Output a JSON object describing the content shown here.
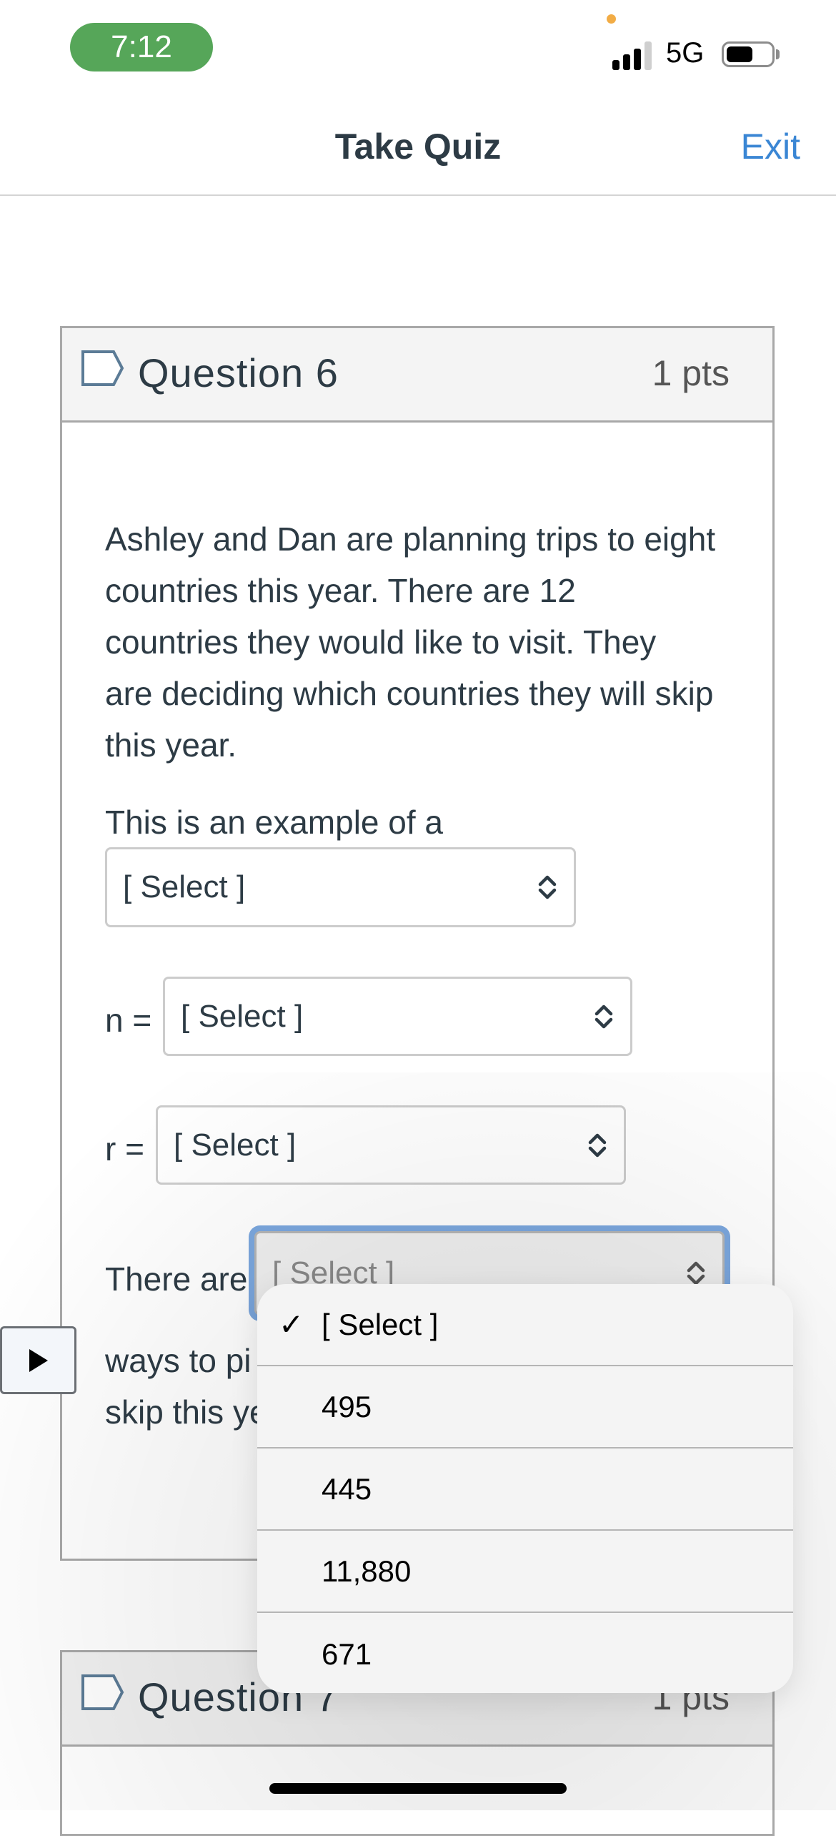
{
  "status_bar": {
    "time": "7:12",
    "network": "5G",
    "signal_bars_active": 3,
    "signal_bars_total": 4,
    "battery_level_percent": 60,
    "time_pill_color": "#56a659",
    "privacy_dot_color": "#f2ac45"
  },
  "header": {
    "title": "Take Quiz",
    "exit_label": "Exit",
    "accent_color": "#3a86d4"
  },
  "question6": {
    "title": "Question 6",
    "points": "1 pts",
    "flag_icon": "flag-outline-icon",
    "body_lines": [
      "Ashley and Dan are planning trips to eight",
      "countries this year.  There are 12",
      "countries they would like to visit.  They",
      "are deciding which countries they will skip",
      "this year."
    ],
    "prompt_example": "This is an example of a",
    "select_example_value": "[ Select ]",
    "n_label": "n =",
    "select_n_value": "[ Select ]",
    "r_label": "r =",
    "select_r_value": "[ Select ]",
    "there_are_label": "There are",
    "select_ways_value": "[ Select ]",
    "ways_line_1_visible": "ways to pi",
    "ways_line_2_visible": "skip this ye"
  },
  "dropdown": {
    "selected_index": 0,
    "check_glyph": "✓",
    "options": [
      "[ Select ]",
      "495",
      "445",
      "11,880",
      "671"
    ]
  },
  "question7": {
    "title": "Question 7",
    "points": "1 pts"
  },
  "play_button_icon": "play-icon"
}
